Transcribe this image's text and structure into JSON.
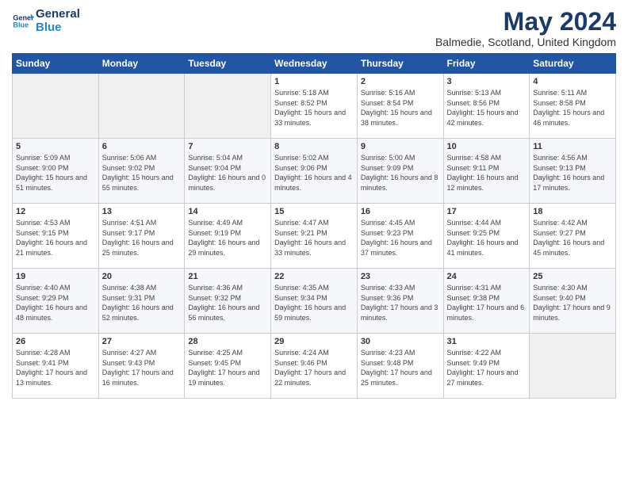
{
  "logo": {
    "line1": "General",
    "line2": "Blue"
  },
  "title": "May 2024",
  "subtitle": "Balmedie, Scotland, United Kingdom",
  "weekdays": [
    "Sunday",
    "Monday",
    "Tuesday",
    "Wednesday",
    "Thursday",
    "Friday",
    "Saturday"
  ],
  "weeks": [
    [
      {
        "day": "",
        "sunrise": "",
        "sunset": "",
        "daylight": ""
      },
      {
        "day": "",
        "sunrise": "",
        "sunset": "",
        "daylight": ""
      },
      {
        "day": "",
        "sunrise": "",
        "sunset": "",
        "daylight": ""
      },
      {
        "day": "1",
        "sunrise": "Sunrise: 5:18 AM",
        "sunset": "Sunset: 8:52 PM",
        "daylight": "Daylight: 15 hours and 33 minutes."
      },
      {
        "day": "2",
        "sunrise": "Sunrise: 5:16 AM",
        "sunset": "Sunset: 8:54 PM",
        "daylight": "Daylight: 15 hours and 38 minutes."
      },
      {
        "day": "3",
        "sunrise": "Sunrise: 5:13 AM",
        "sunset": "Sunset: 8:56 PM",
        "daylight": "Daylight: 15 hours and 42 minutes."
      },
      {
        "day": "4",
        "sunrise": "Sunrise: 5:11 AM",
        "sunset": "Sunset: 8:58 PM",
        "daylight": "Daylight: 15 hours and 46 minutes."
      }
    ],
    [
      {
        "day": "5",
        "sunrise": "Sunrise: 5:09 AM",
        "sunset": "Sunset: 9:00 PM",
        "daylight": "Daylight: 15 hours and 51 minutes."
      },
      {
        "day": "6",
        "sunrise": "Sunrise: 5:06 AM",
        "sunset": "Sunset: 9:02 PM",
        "daylight": "Daylight: 15 hours and 55 minutes."
      },
      {
        "day": "7",
        "sunrise": "Sunrise: 5:04 AM",
        "sunset": "Sunset: 9:04 PM",
        "daylight": "Daylight: 16 hours and 0 minutes."
      },
      {
        "day": "8",
        "sunrise": "Sunrise: 5:02 AM",
        "sunset": "Sunset: 9:06 PM",
        "daylight": "Daylight: 16 hours and 4 minutes."
      },
      {
        "day": "9",
        "sunrise": "Sunrise: 5:00 AM",
        "sunset": "Sunset: 9:09 PM",
        "daylight": "Daylight: 16 hours and 8 minutes."
      },
      {
        "day": "10",
        "sunrise": "Sunrise: 4:58 AM",
        "sunset": "Sunset: 9:11 PM",
        "daylight": "Daylight: 16 hours and 12 minutes."
      },
      {
        "day": "11",
        "sunrise": "Sunrise: 4:56 AM",
        "sunset": "Sunset: 9:13 PM",
        "daylight": "Daylight: 16 hours and 17 minutes."
      }
    ],
    [
      {
        "day": "12",
        "sunrise": "Sunrise: 4:53 AM",
        "sunset": "Sunset: 9:15 PM",
        "daylight": "Daylight: 16 hours and 21 minutes."
      },
      {
        "day": "13",
        "sunrise": "Sunrise: 4:51 AM",
        "sunset": "Sunset: 9:17 PM",
        "daylight": "Daylight: 16 hours and 25 minutes."
      },
      {
        "day": "14",
        "sunrise": "Sunrise: 4:49 AM",
        "sunset": "Sunset: 9:19 PM",
        "daylight": "Daylight: 16 hours and 29 minutes."
      },
      {
        "day": "15",
        "sunrise": "Sunrise: 4:47 AM",
        "sunset": "Sunset: 9:21 PM",
        "daylight": "Daylight: 16 hours and 33 minutes."
      },
      {
        "day": "16",
        "sunrise": "Sunrise: 4:45 AM",
        "sunset": "Sunset: 9:23 PM",
        "daylight": "Daylight: 16 hours and 37 minutes."
      },
      {
        "day": "17",
        "sunrise": "Sunrise: 4:44 AM",
        "sunset": "Sunset: 9:25 PM",
        "daylight": "Daylight: 16 hours and 41 minutes."
      },
      {
        "day": "18",
        "sunrise": "Sunrise: 4:42 AM",
        "sunset": "Sunset: 9:27 PM",
        "daylight": "Daylight: 16 hours and 45 minutes."
      }
    ],
    [
      {
        "day": "19",
        "sunrise": "Sunrise: 4:40 AM",
        "sunset": "Sunset: 9:29 PM",
        "daylight": "Daylight: 16 hours and 48 minutes."
      },
      {
        "day": "20",
        "sunrise": "Sunrise: 4:38 AM",
        "sunset": "Sunset: 9:31 PM",
        "daylight": "Daylight: 16 hours and 52 minutes."
      },
      {
        "day": "21",
        "sunrise": "Sunrise: 4:36 AM",
        "sunset": "Sunset: 9:32 PM",
        "daylight": "Daylight: 16 hours and 56 minutes."
      },
      {
        "day": "22",
        "sunrise": "Sunrise: 4:35 AM",
        "sunset": "Sunset: 9:34 PM",
        "daylight": "Daylight: 16 hours and 59 minutes."
      },
      {
        "day": "23",
        "sunrise": "Sunrise: 4:33 AM",
        "sunset": "Sunset: 9:36 PM",
        "daylight": "Daylight: 17 hours and 3 minutes."
      },
      {
        "day": "24",
        "sunrise": "Sunrise: 4:31 AM",
        "sunset": "Sunset: 9:38 PM",
        "daylight": "Daylight: 17 hours and 6 minutes."
      },
      {
        "day": "25",
        "sunrise": "Sunrise: 4:30 AM",
        "sunset": "Sunset: 9:40 PM",
        "daylight": "Daylight: 17 hours and 9 minutes."
      }
    ],
    [
      {
        "day": "26",
        "sunrise": "Sunrise: 4:28 AM",
        "sunset": "Sunset: 9:41 PM",
        "daylight": "Daylight: 17 hours and 13 minutes."
      },
      {
        "day": "27",
        "sunrise": "Sunrise: 4:27 AM",
        "sunset": "Sunset: 9:43 PM",
        "daylight": "Daylight: 17 hours and 16 minutes."
      },
      {
        "day": "28",
        "sunrise": "Sunrise: 4:25 AM",
        "sunset": "Sunset: 9:45 PM",
        "daylight": "Daylight: 17 hours and 19 minutes."
      },
      {
        "day": "29",
        "sunrise": "Sunrise: 4:24 AM",
        "sunset": "Sunset: 9:46 PM",
        "daylight": "Daylight: 17 hours and 22 minutes."
      },
      {
        "day": "30",
        "sunrise": "Sunrise: 4:23 AM",
        "sunset": "Sunset: 9:48 PM",
        "daylight": "Daylight: 17 hours and 25 minutes."
      },
      {
        "day": "31",
        "sunrise": "Sunrise: 4:22 AM",
        "sunset": "Sunset: 9:49 PM",
        "daylight": "Daylight: 17 hours and 27 minutes."
      },
      {
        "day": "",
        "sunrise": "",
        "sunset": "",
        "daylight": ""
      }
    ]
  ]
}
